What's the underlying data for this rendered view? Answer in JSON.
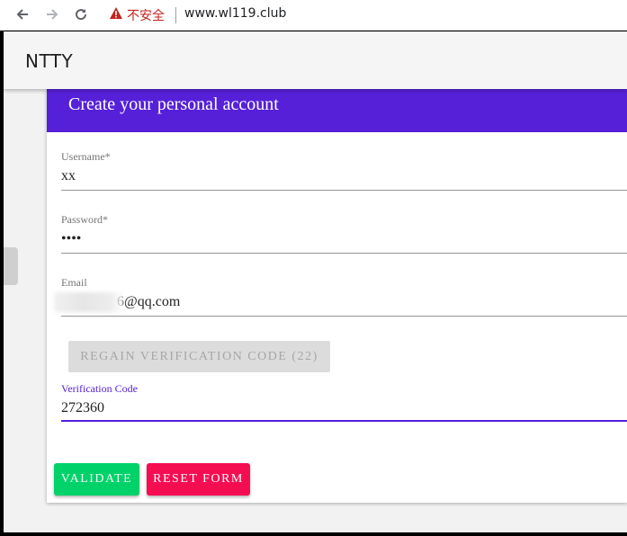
{
  "browser": {
    "security_label": "不安全",
    "url": "www.wl119.club"
  },
  "app": {
    "title": "NTTY"
  },
  "form": {
    "heading": "Create your personal account",
    "username": {
      "label": "Username*",
      "value": "xx"
    },
    "password": {
      "label": "Password*",
      "value": "••••"
    },
    "email": {
      "label": "Email",
      "value": "6@qq.com"
    },
    "regain_button": "REGAIN VERIFICATION CODE (22)",
    "verification": {
      "label": "Verification Code",
      "value": "272360"
    },
    "validate_button": "VALIDATE",
    "reset_button": "RESET FORM"
  },
  "colors": {
    "accent": "#5620d9",
    "validate": "#00d26a",
    "reset": "#f50d52",
    "insecure": "#c5221f"
  }
}
